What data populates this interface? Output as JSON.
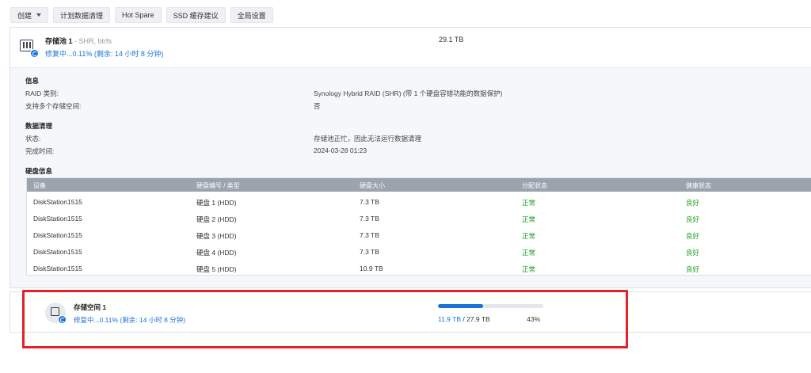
{
  "toolbar": {
    "create": "创建",
    "scrub_schedule": "计划数据清理",
    "hot_spare": "Hot Spare",
    "ssd_cache": "SSD 缓存建议",
    "global_settings": "全局设置"
  },
  "pool": {
    "name": "存储池 1",
    "type": " - SHR, btrfs",
    "status": "修复中...0.11% (剩余: 14 小时 8 分钟)",
    "size": "29.1 TB",
    "info": {
      "title": "信息",
      "raid_label": "RAID 类别:",
      "raid_value": "Synology Hybrid RAID (SHR) (带 1 个硬盘容错功能的数据保护)",
      "multi_label": "支持多个存储空间:",
      "multi_value": "否"
    },
    "scrub": {
      "title": "数据清理",
      "status_label": "状态:",
      "status_value": "存储池正忙，因此无法运行数据清理",
      "done_label": "完成时间:",
      "done_value": "2024-03-28 01:23"
    },
    "disks": {
      "title": "硬盘信息",
      "headers": [
        "设备",
        "硬盘编号 / 类型",
        "硬盘大小",
        "分配状态",
        "健康状态"
      ],
      "rows": [
        [
          "DiskStation1515",
          "硬盘 1 (HDD)",
          "7.3 TB",
          "正常",
          "良好"
        ],
        [
          "DiskStation1515",
          "硬盘 2 (HDD)",
          "7.3 TB",
          "正常",
          "良好"
        ],
        [
          "DiskStation1515",
          "硬盘 3 (HDD)",
          "7.3 TB",
          "正常",
          "良好"
        ],
        [
          "DiskStation1515",
          "硬盘 4 (HDD)",
          "7.3 TB",
          "正常",
          "良好"
        ],
        [
          "DiskStation1515",
          "硬盘 5 (HDD)",
          "10.9 TB",
          "正常",
          "良好"
        ]
      ]
    }
  },
  "volume": {
    "name": "存储空间 1",
    "status": "修复中...0.11% (剩余: 14 小时 8 分钟)",
    "used": "11.9 TB",
    "sep": " / ",
    "total": "27.9 TB",
    "percent_label": "43%",
    "usage_fraction": 0.43
  },
  "colors": {
    "accent": "#1a73d9",
    "ok": "#20a020",
    "highlight": "#e8202a"
  }
}
